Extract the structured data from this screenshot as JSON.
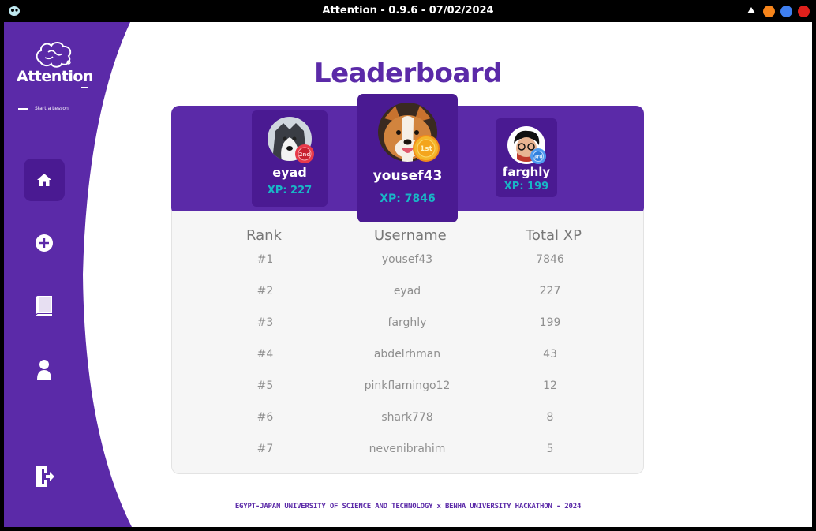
{
  "window": {
    "title": "Attention - 0.9.6 - 07/02/2024",
    "controls": {
      "minimize_color": "#f7851b",
      "maximize_color": "#3f7ff0",
      "close_color": "#e0201b"
    }
  },
  "brand": {
    "name": "Attention",
    "tagline": "Start a Lesson",
    "primary_color": "#5b2aa8",
    "dark_color": "#4a1a92",
    "accent_color": "#19b6c6"
  },
  "sidebar": {
    "items": [
      {
        "icon": "home-icon",
        "active": true
      },
      {
        "icon": "add-circle-icon",
        "active": false
      },
      {
        "icon": "book-icon",
        "active": false
      },
      {
        "icon": "profile-icon",
        "active": false
      },
      {
        "icon": "logout-icon",
        "active": false
      }
    ]
  },
  "main": {
    "title": "Leaderboard",
    "podium": {
      "first": {
        "username": "yousef43",
        "xp": "XP: 7846",
        "medal": "1st",
        "avatar_icon": "corgi-avatar"
      },
      "second": {
        "username": "eyad",
        "xp": "XP: 227",
        "medal": "2nd",
        "avatar_icon": "husky-avatar"
      },
      "third": {
        "username": "farghly",
        "xp": "XP: 199",
        "medal": "3rd",
        "avatar_icon": "cartoon-avatar"
      }
    },
    "table": {
      "columns": [
        "Rank",
        "Username",
        "Total XP"
      ],
      "rows": [
        {
          "rank": "#1",
          "username": "yousef43",
          "xp": "7846"
        },
        {
          "rank": "#2",
          "username": "eyad",
          "xp": "227"
        },
        {
          "rank": "#3",
          "username": "farghly",
          "xp": "199"
        },
        {
          "rank": "#4",
          "username": "abdelrhman",
          "xp": "43"
        },
        {
          "rank": "#5",
          "username": "pinkflamingo12",
          "xp": "12"
        },
        {
          "rank": "#6",
          "username": "shark778",
          "xp": "8"
        },
        {
          "rank": "#7",
          "username": "nevenibrahim",
          "xp": "5"
        }
      ]
    }
  },
  "footer": {
    "text": "EGYPT-JAPAN UNIVERSITY OF SCIENCE AND TECHNOLOGY x BENHA UNIVERSITY HACKATHON - 2024"
  }
}
